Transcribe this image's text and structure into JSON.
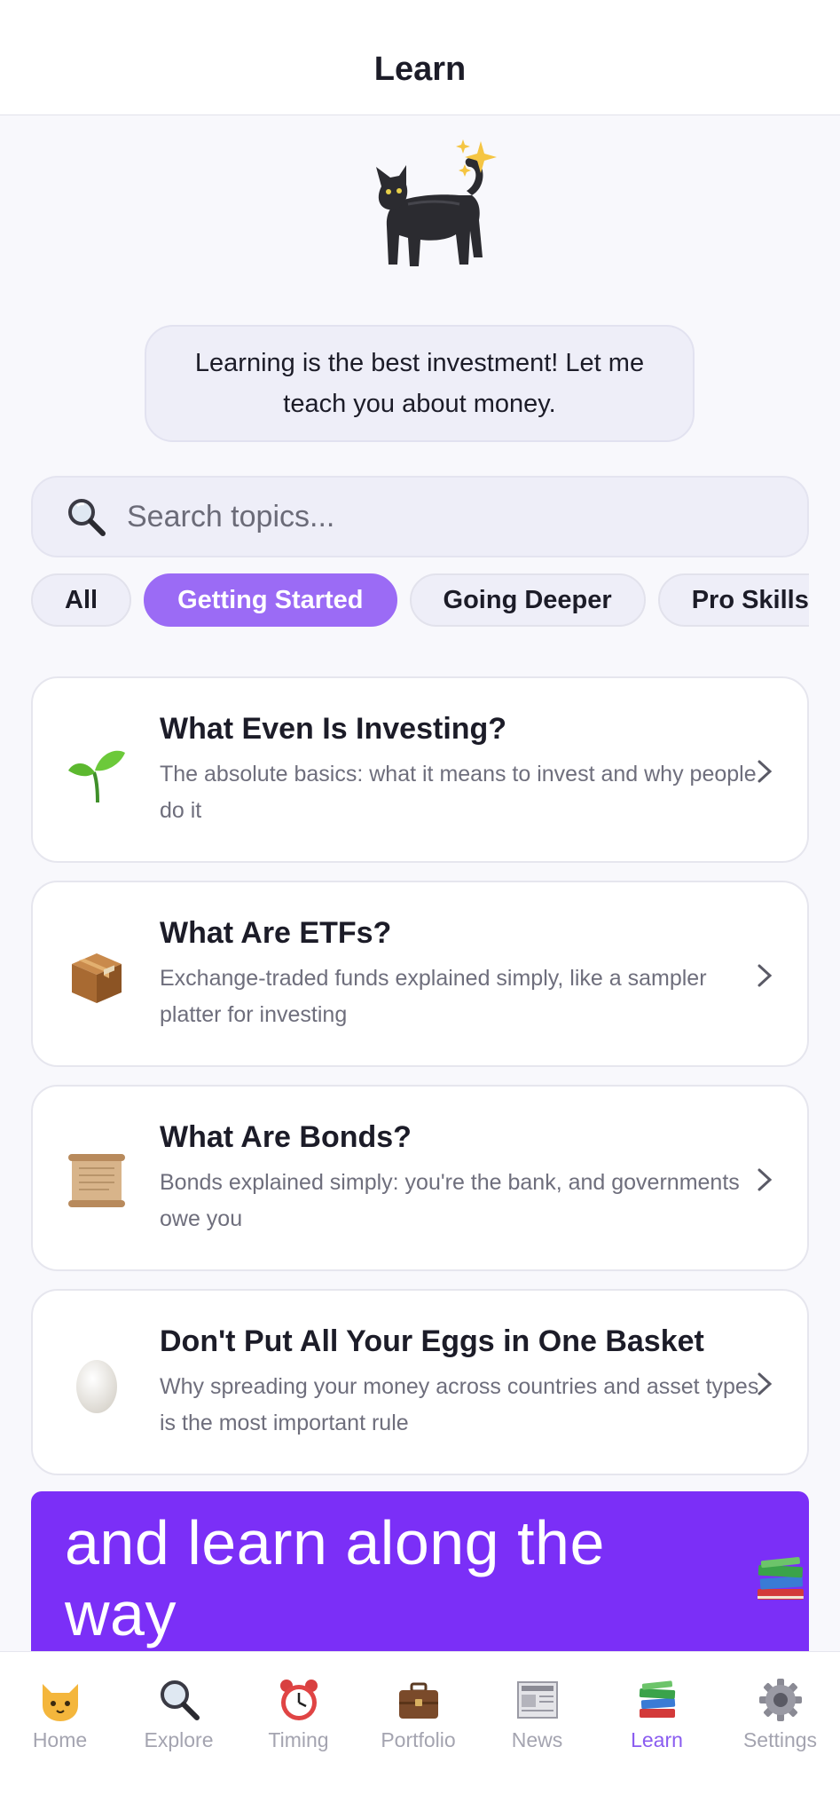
{
  "header": {
    "title": "Learn"
  },
  "mascot": {
    "icon": "black-cat-icon",
    "accent_icon": "sparkles-icon"
  },
  "bubble": {
    "text": "Learning is the best investment! Let me teach you about money."
  },
  "search": {
    "placeholder": "Search topics...",
    "value": "",
    "icon": "magnifier-icon"
  },
  "filters": {
    "items": [
      {
        "label": "All",
        "active": false
      },
      {
        "label": "Getting Started",
        "active": true
      },
      {
        "label": "Going Deeper",
        "active": false
      },
      {
        "label": "Pro Skills",
        "active": false
      }
    ]
  },
  "topics": [
    {
      "icon": "seedling-icon",
      "title": "What Even Is Investing?",
      "description": "The absolute basics: what it means to invest and why people do it"
    },
    {
      "icon": "package-icon",
      "title": "What Are ETFs?",
      "description": "Exchange-traded funds explained simply, like a sampler platter for investing"
    },
    {
      "icon": "scroll-icon",
      "title": "What Are Bonds?",
      "description": "Bonds explained simply: you're the bank, and governments owe you"
    },
    {
      "icon": "egg-icon",
      "title": "Don't Put All Your Eggs in One Basket",
      "description": "Why spreading your money across countries and asset types is the most important rule"
    }
  ],
  "promo": {
    "text": "and learn along the way",
    "icon": "books-icon"
  },
  "tabbar": {
    "items": [
      {
        "label": "Home",
        "icon": "cat-face-icon",
        "active": false
      },
      {
        "label": "Explore",
        "icon": "magnifier-icon",
        "active": false
      },
      {
        "label": "Timing",
        "icon": "alarm-clock-icon",
        "active": false
      },
      {
        "label": "Portfolio",
        "icon": "briefcase-icon",
        "active": false
      },
      {
        "label": "News",
        "icon": "newspaper-icon",
        "active": false
      },
      {
        "label": "Learn",
        "icon": "books-icon",
        "active": true
      },
      {
        "label": "Settings",
        "icon": "gear-icon",
        "active": false
      }
    ]
  },
  "colors": {
    "accent": "#9b6bf5",
    "promo_background": "#7b2ff7",
    "active_tab": "#8a5cf0",
    "bubble_background": "#eeeef8"
  }
}
